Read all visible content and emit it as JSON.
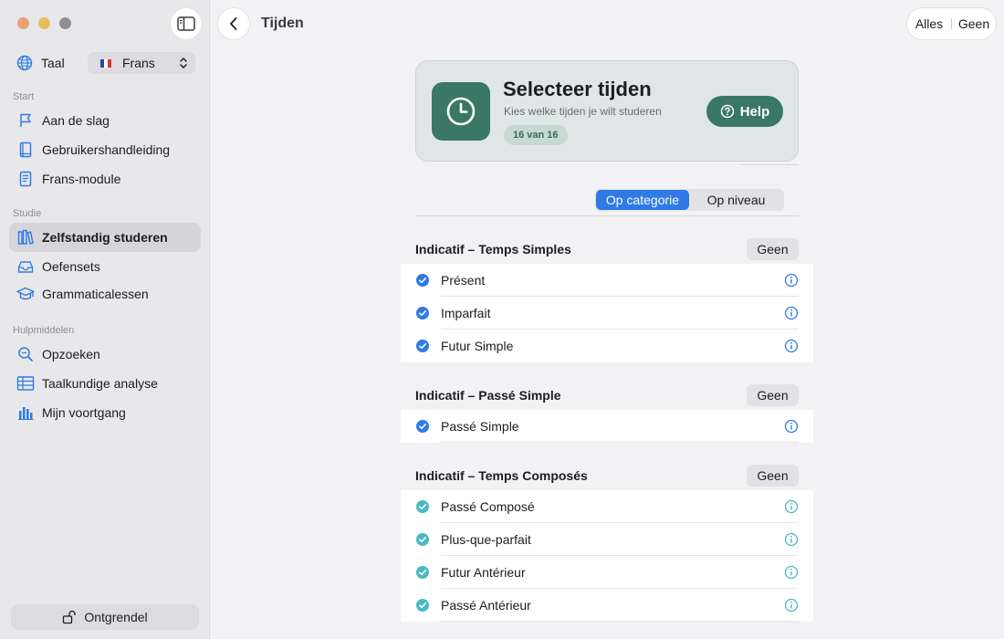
{
  "colors": {
    "accent": "#2f7ae5",
    "teal": "#3b7765",
    "check_blue": "#2f7ae5",
    "check_teal": "#4bb8c4"
  },
  "window": {
    "title": "Tijden"
  },
  "toolbar": {
    "all_label": "Alles",
    "none_label": "Geen"
  },
  "sidebar": {
    "language_label": "Taal",
    "language_value": "Frans",
    "sections": {
      "start": "Start",
      "study": "Studie",
      "tools": "Hulpmiddelen"
    },
    "items": [
      {
        "label": "Aan de slag",
        "icon": "flag-icon"
      },
      {
        "label": "Gebruikershandleiding",
        "icon": "book-icon"
      },
      {
        "label": "Frans-module",
        "icon": "document-icon"
      },
      {
        "label": "Zelfstandig studeren",
        "icon": "books-icon"
      },
      {
        "label": "Oefensets",
        "icon": "tray-icon"
      },
      {
        "label": "Grammaticalessen",
        "icon": "graduation-cap-icon"
      },
      {
        "label": "Opzoeken",
        "icon": "magnifier-icon"
      },
      {
        "label": "Taalkundige analyse",
        "icon": "table-icon"
      },
      {
        "label": "Mijn voortgang",
        "icon": "bar-chart-icon"
      }
    ],
    "unlock_label": "Ontgrendel"
  },
  "hero": {
    "title": "Selecteer tijden",
    "subtitle": "Kies welke tijden je wilt studeren",
    "count_badge": "16 van 16",
    "help_label": "Help"
  },
  "segment": {
    "by_category": "Op categorie",
    "by_level": "Op niveau"
  },
  "groups": [
    {
      "title": "Indicatif – Temps Simples",
      "none_label": "Geen",
      "rows": [
        "Présent",
        "Imparfait",
        "Futur Simple"
      ]
    },
    {
      "title": "Indicatif – Passé Simple",
      "none_label": "Geen",
      "rows": [
        "Passé Simple"
      ]
    },
    {
      "title": "Indicatif – Temps Composés",
      "none_label": "Geen",
      "rows": [
        "Passé Composé",
        "Plus-que-parfait",
        "Futur Antérieur",
        "Passé Antérieur"
      ]
    }
  ]
}
